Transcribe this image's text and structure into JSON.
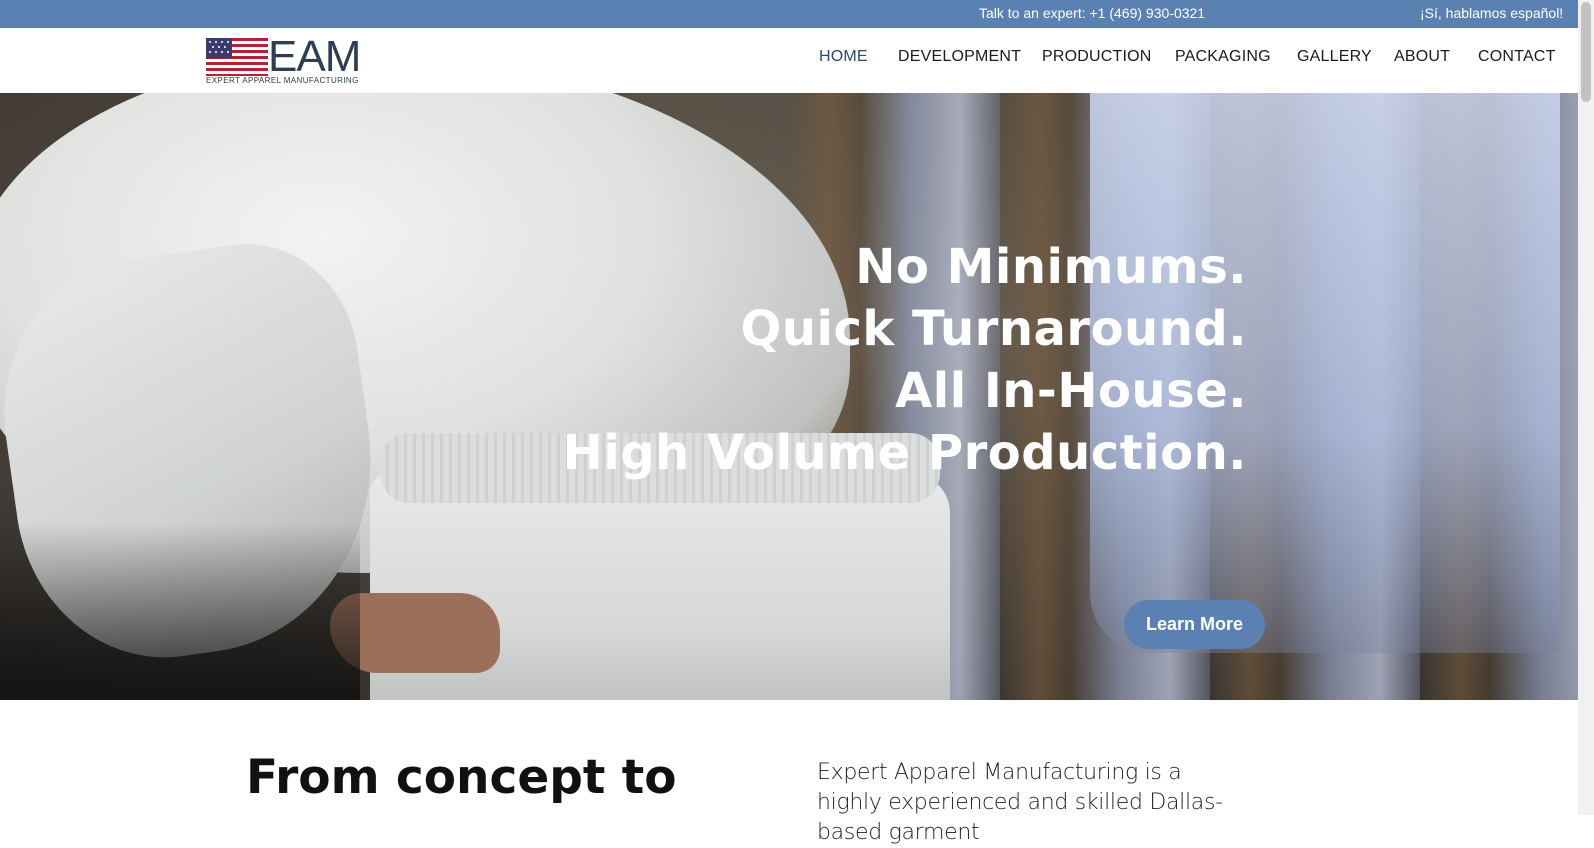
{
  "topbar": {
    "phone": "Talk to an expert: +1 (469) 930-0321",
    "spanish": "¡Sí, hablamos español!"
  },
  "logo": {
    "letters": "EAM",
    "tagline": "EXPERT APPAREL MANUFACTURING",
    "icon": "us-flag-icon"
  },
  "nav": {
    "items": [
      "HOME",
      "DEVELOPMENT",
      "PRODUCTION",
      "PACKAGING",
      "GALLERY",
      "ABOUT",
      "CONTACT"
    ],
    "active": "HOME"
  },
  "hero": {
    "lines": [
      "No Minimums.",
      "Quick Turnaround.",
      "All In-House.",
      "High Volume Production."
    ],
    "cta": "Learn More"
  },
  "intro": {
    "heading": "From concept to",
    "body": "Expert Apparel Manufacturing is a highly experienced and skilled Dallas-based garment"
  },
  "colors": {
    "brand_blue": "#5b80b2",
    "nav_active": "#2d4a6a"
  }
}
